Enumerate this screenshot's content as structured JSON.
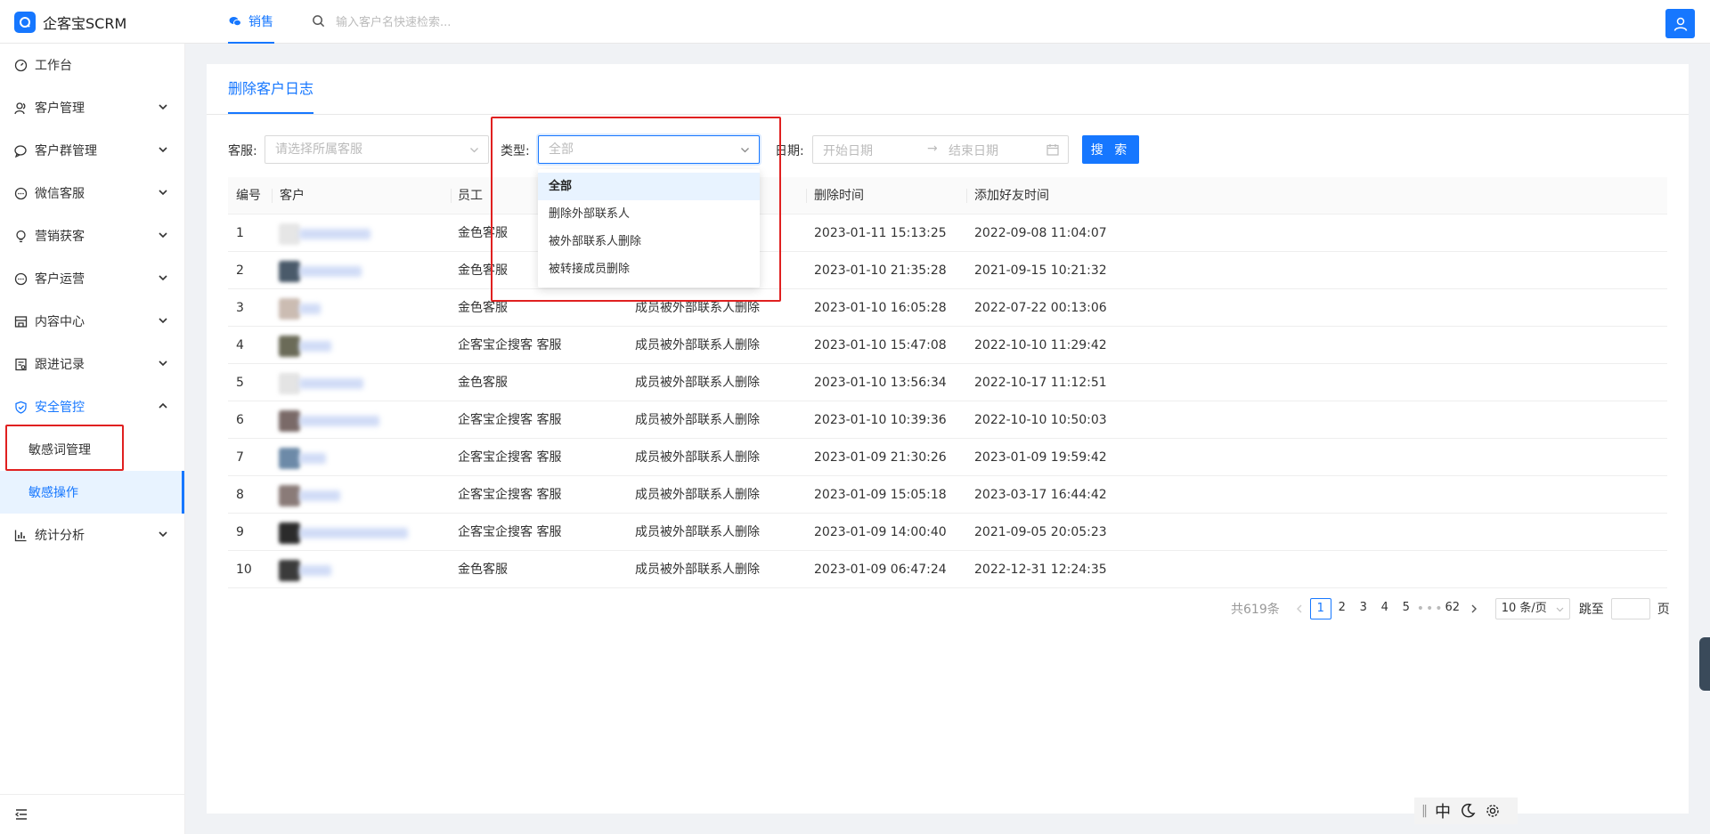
{
  "app": {
    "name": "企客宝SCRM"
  },
  "header": {
    "tab_label": "销售",
    "search_placeholder": "输入客户名快速检索..."
  },
  "sidebar": {
    "items": [
      {
        "label": "工作台",
        "icon": "dashboard-icon"
      },
      {
        "label": "客户管理",
        "icon": "users-icon"
      },
      {
        "label": "客户群管理",
        "icon": "group-chat-icon"
      },
      {
        "label": "微信客服",
        "icon": "chat-bubble-icon"
      },
      {
        "label": "营销获客",
        "icon": "bulb-icon"
      },
      {
        "label": "客户运营",
        "icon": "chat-bubble-icon"
      },
      {
        "label": "内容中心",
        "icon": "store-icon"
      },
      {
        "label": "跟进记录",
        "icon": "record-icon"
      },
      {
        "label": "安全管控",
        "icon": "shield-icon"
      },
      {
        "label": "统计分析",
        "icon": "bar-chart-icon"
      }
    ],
    "sub_items": [
      {
        "label": "敏感词管理"
      },
      {
        "label": "敏感操作"
      }
    ]
  },
  "page": {
    "tab_title": "删除客户日志"
  },
  "filters": {
    "agent_label": "客服:",
    "agent_placeholder": "请选择所属客服",
    "type_label": "类型:",
    "type_value": "全部",
    "date_label": "日期:",
    "date_start": "开始日期",
    "date_end": "结束日期",
    "search_button": "搜 索"
  },
  "dropdown": {
    "options": [
      "全部",
      "删除外部联系人",
      "被外部联系人删除",
      "被转接成员删除"
    ],
    "selected": "全部"
  },
  "table": {
    "headers": [
      "编号",
      "客户",
      "员工",
      "类型",
      "删除时间",
      "添加好友时间"
    ],
    "rows": [
      {
        "no": "1",
        "staff": "金色客服",
        "type": "",
        "deleted": "2023-01-11 15:13:25",
        "added": "2022-09-08 11:04:07"
      },
      {
        "no": "2",
        "staff": "金色客服",
        "type": "",
        "deleted": "2023-01-10 21:35:28",
        "added": "2021-09-15 10:21:32"
      },
      {
        "no": "3",
        "staff": "金色客服",
        "type": "成员被外部联系人删除",
        "deleted": "2023-01-10 16:05:28",
        "added": "2022-07-22 00:13:06"
      },
      {
        "no": "4",
        "staff": "企客宝企搜客 客服",
        "type": "成员被外部联系人删除",
        "deleted": "2023-01-10 15:47:08",
        "added": "2022-10-10 11:29:42"
      },
      {
        "no": "5",
        "staff": "金色客服",
        "type": "成员被外部联系人删除",
        "deleted": "2023-01-10 13:56:34",
        "added": "2022-10-17 11:12:51"
      },
      {
        "no": "6",
        "staff": "企客宝企搜客 客服",
        "type": "成员被外部联系人删除",
        "deleted": "2023-01-10 10:39:36",
        "added": "2022-10-10 10:50:03"
      },
      {
        "no": "7",
        "staff": "企客宝企搜客 客服",
        "type": "成员被外部联系人删除",
        "deleted": "2023-01-09 21:30:26",
        "added": "2023-01-09 19:59:42"
      },
      {
        "no": "8",
        "staff": "企客宝企搜客 客服",
        "type": "成员被外部联系人删除",
        "deleted": "2023-01-09 15:05:18",
        "added": "2023-03-17 16:44:42"
      },
      {
        "no": "9",
        "staff": "企客宝企搜客 客服",
        "type": "成员被外部联系人删除",
        "deleted": "2023-01-09 14:00:40",
        "added": "2021-09-05 20:05:23"
      },
      {
        "no": "10",
        "staff": "金色客服",
        "type": "成员被外部联系人删除",
        "deleted": "2023-01-09 06:47:24",
        "added": "2022-12-31 12:24:35"
      }
    ]
  },
  "pagination": {
    "total": "共619条",
    "pages": [
      "1",
      "2",
      "3",
      "4",
      "5"
    ],
    "ellipsis": "•••",
    "last": "62",
    "current": "1",
    "page_size": "10 条/页",
    "jump_label": "跳至",
    "page_suffix": "页"
  },
  "ime": {
    "lang": "中"
  },
  "colors": {
    "primary": "#1677ff",
    "highlight": "#e02020"
  }
}
